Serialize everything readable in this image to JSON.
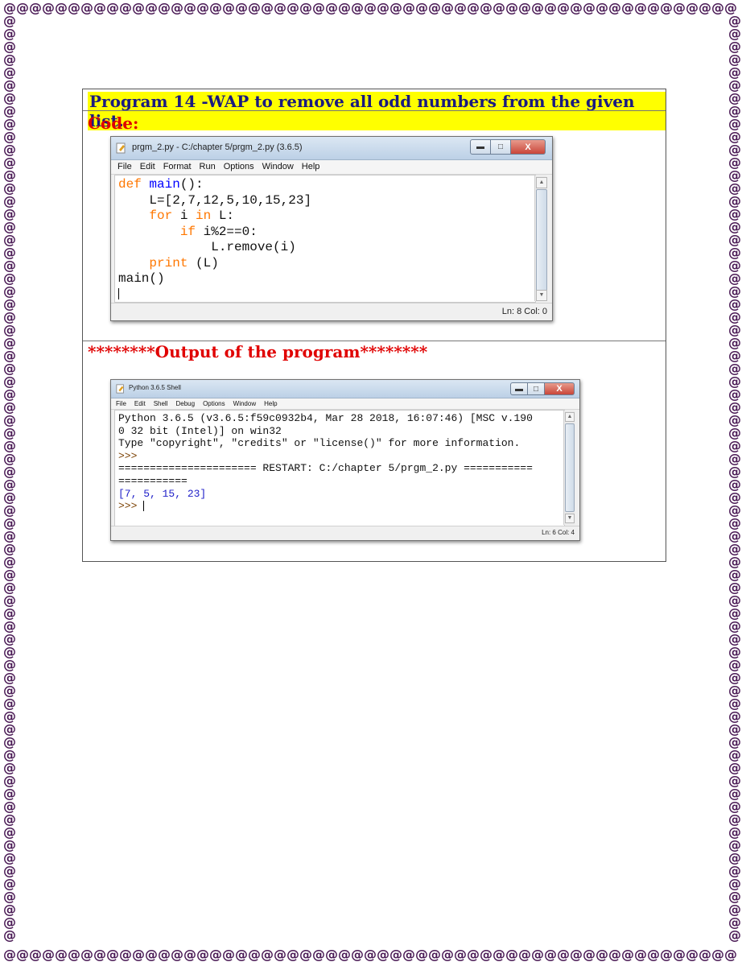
{
  "document": {
    "program_title": "Program 14 -WAP to remove all odd numbers from the given list.",
    "code_label": "Code:",
    "output_heading": "********Output of the program********"
  },
  "border": {
    "glyph": "@",
    "color": "#4a1a55"
  },
  "editor_window": {
    "title": "prgm_2.py - C:/chapter 5/prgm_2.py (3.6.5)",
    "menu": [
      "File",
      "Edit",
      "Format",
      "Run",
      "Options",
      "Window",
      "Help"
    ],
    "code_lines": [
      {
        "indent": "",
        "parts": [
          {
            "t": "def ",
            "c": "kw"
          },
          {
            "t": "main",
            "c": "fn"
          },
          {
            "t": "():",
            "c": ""
          }
        ]
      },
      {
        "indent": "    ",
        "parts": [
          {
            "t": "L=[2,7,12,5,10,15,23]",
            "c": ""
          }
        ]
      },
      {
        "indent": "    ",
        "parts": [
          {
            "t": "for ",
            "c": "kw"
          },
          {
            "t": "i ",
            "c": ""
          },
          {
            "t": "in ",
            "c": "kw"
          },
          {
            "t": "L:",
            "c": ""
          }
        ]
      },
      {
        "indent": "        ",
        "parts": [
          {
            "t": "if ",
            "c": "kw"
          },
          {
            "t": "i%2==0:",
            "c": ""
          }
        ]
      },
      {
        "indent": "            ",
        "parts": [
          {
            "t": "L.remove(i)",
            "c": ""
          }
        ]
      },
      {
        "indent": "    ",
        "parts": [
          {
            "t": "print ",
            "c": "kw"
          },
          {
            "t": "(L)",
            "c": ""
          }
        ]
      },
      {
        "indent": "",
        "parts": [
          {
            "t": "main()",
            "c": ""
          }
        ]
      }
    ],
    "status": "Ln: 8   Col: 0"
  },
  "shell_window": {
    "title": "Python 3.6.5 Shell",
    "menu": [
      "File",
      "Edit",
      "Shell",
      "Debug",
      "Options",
      "Window",
      "Help"
    ],
    "lines": [
      {
        "t": "Python 3.6.5 (v3.6.5:f59c0932b4, Mar 28 2018, 16:07:46) [MSC v.190",
        "c": ""
      },
      {
        "t": "0 32 bit (Intel)] on win32",
        "c": ""
      },
      {
        "t": "Type \"copyright\", \"credits\" or \"license()\" for more information.",
        "c": ""
      },
      {
        "t": ">>>",
        "c": "prompt"
      },
      {
        "t": "====================== RESTART: C:/chapter 5/prgm_2.py ===========",
        "c": ""
      },
      {
        "t": "===========",
        "c": ""
      },
      {
        "t": "[7, 5, 15, 23]",
        "c": "out"
      },
      {
        "t": ">>> ",
        "c": "prompt"
      }
    ],
    "status": "Ln: 6   Col: 4"
  }
}
